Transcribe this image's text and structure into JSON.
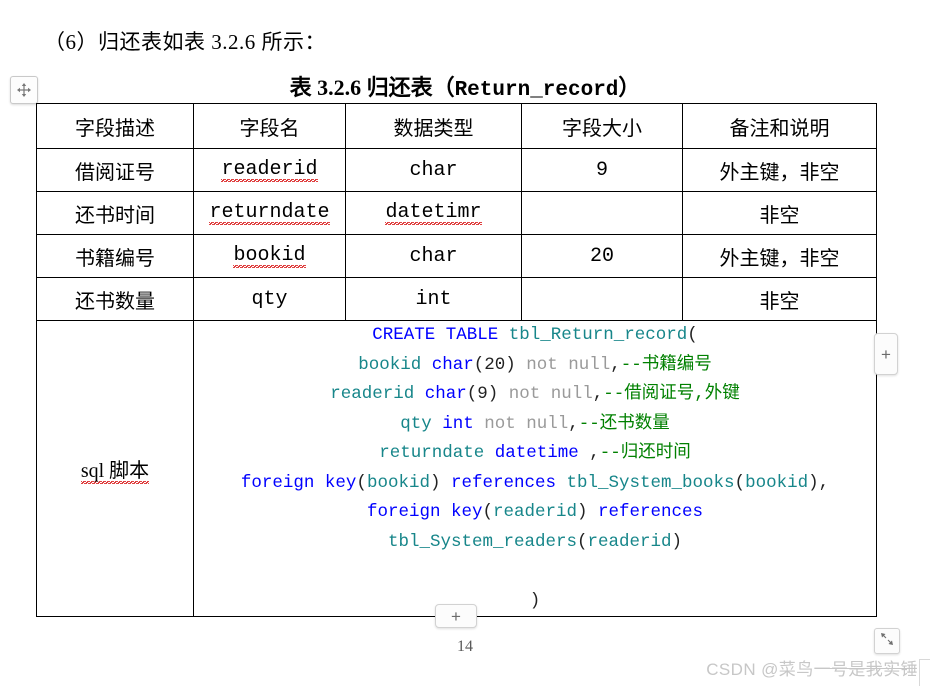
{
  "document": {
    "intro_text": "（6）归还表如表 3.2.6 所示：",
    "caption_cn": "表 3.2.6 归还表（",
    "caption_latin": "Return_record",
    "caption_close": "）",
    "page_number": "14",
    "watermark": "CSDN @菜鸟一号是我实锤"
  },
  "controls": {
    "move_handle_icon": "move-arrows-icon",
    "add_column_label": "+",
    "add_row_label": "+",
    "resize_icon": "resize-diagonal-icon"
  },
  "table": {
    "headers": [
      "字段描述",
      "字段名",
      "数据类型",
      "字段大小",
      "备注和说明"
    ],
    "rows": [
      {
        "desc": "借阅证号",
        "name": "readerid",
        "type": "char",
        "size": "9",
        "note": "外主键，非空",
        "name_misspelled": true,
        "type_misspelled": false
      },
      {
        "desc": "还书时间",
        "name": "returndate",
        "type": "datetimr",
        "size": "",
        "note": "非空",
        "name_misspelled": true,
        "type_misspelled": true
      },
      {
        "desc": "书籍编号",
        "name": "bookid",
        "type": "char",
        "size": "20",
        "note": "外主键，非空",
        "name_misspelled": true,
        "type_misspelled": false
      },
      {
        "desc": "还书数量",
        "name": "qty",
        "type": "int",
        "size": "",
        "note": "非空",
        "name_misspelled": false,
        "type_misspelled": false
      }
    ],
    "sql_label": "sql 脚本",
    "sql_lines": [
      [
        {
          "t": "CREATE TABLE ",
          "c": "kw"
        },
        {
          "t": "tbl_Return_record",
          "c": "idn"
        },
        {
          "t": "(",
          "c": "pln"
        }
      ],
      [
        {
          "t": "bookid",
          "c": "idn"
        },
        {
          "t": " ",
          "c": "pln"
        },
        {
          "t": "char",
          "c": "kw"
        },
        {
          "t": "(20)",
          "c": "pln"
        },
        {
          "t": " not null",
          "c": "gry"
        },
        {
          "t": ",",
          "c": "pln"
        },
        {
          "t": "--书籍编号",
          "c": "cmt"
        }
      ],
      [
        {
          "t": "readerid",
          "c": "idn"
        },
        {
          "t": " ",
          "c": "pln"
        },
        {
          "t": "char",
          "c": "kw"
        },
        {
          "t": "(9)",
          "c": "pln"
        },
        {
          "t": " not null",
          "c": "gry"
        },
        {
          "t": ",",
          "c": "pln"
        },
        {
          "t": "--借阅证号,外键",
          "c": "cmt"
        }
      ],
      [
        {
          "t": "qty",
          "c": "idn"
        },
        {
          "t": " ",
          "c": "pln"
        },
        {
          "t": "int",
          "c": "kw"
        },
        {
          "t": " not null",
          "c": "gry"
        },
        {
          "t": ",",
          "c": "pln"
        },
        {
          "t": "--还书数量",
          "c": "cmt"
        }
      ],
      [
        {
          "t": "returndate",
          "c": "idn"
        },
        {
          "t": " ",
          "c": "pln"
        },
        {
          "t": "datetime",
          "c": "kw"
        },
        {
          "t": " ,",
          "c": "pln"
        },
        {
          "t": "--归还时间",
          "c": "cmt"
        }
      ],
      [
        {
          "t": "foreign key",
          "c": "kw"
        },
        {
          "t": "(",
          "c": "pln"
        },
        {
          "t": "bookid",
          "c": "idn"
        },
        {
          "t": ") ",
          "c": "pln"
        },
        {
          "t": "references",
          "c": "kw"
        },
        {
          "t": " ",
          "c": "pln"
        },
        {
          "t": "tbl_System_books",
          "c": "idn"
        },
        {
          "t": "(",
          "c": "pln"
        },
        {
          "t": "bookid",
          "c": "idn"
        },
        {
          "t": "),",
          "c": "pln"
        }
      ],
      [
        {
          "t": "foreign key",
          "c": "kw"
        },
        {
          "t": "(",
          "c": "pln"
        },
        {
          "t": "readerid",
          "c": "idn"
        },
        {
          "t": ") ",
          "c": "pln"
        },
        {
          "t": "references",
          "c": "kw"
        }
      ],
      [
        {
          "t": "tbl_System_readers",
          "c": "idn"
        },
        {
          "t": "(",
          "c": "pln"
        },
        {
          "t": "readerid",
          "c": "idn"
        },
        {
          "t": ")",
          "c": "pln"
        }
      ],
      [],
      [
        {
          "t": ")",
          "c": "pln"
        }
      ]
    ]
  }
}
